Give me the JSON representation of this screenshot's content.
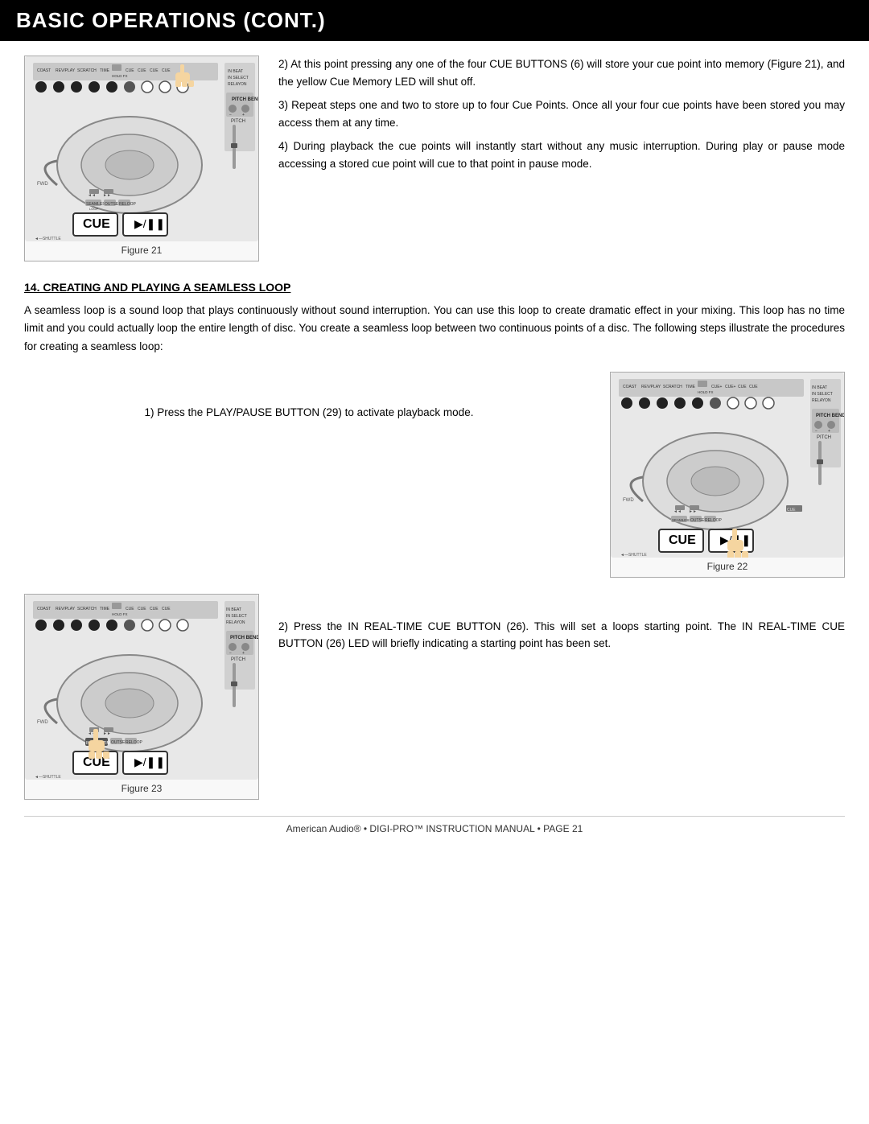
{
  "header": {
    "title": "BASIC OPERATIONS (CONT.)"
  },
  "section1": {
    "figure_label": "Figure 21",
    "points": [
      "2) At this point pressing any one of the four CUE BUTTONS (6) will store your cue point into memory (Figure 21), and the yellow Cue Memory LED will shut off.",
      "3) Repeat steps one and two to store up to four Cue Points. Once all your four cue points have been stored you may access them at any time.",
      "4) During playback the cue points will instantly start without any music interruption. During play or pause mode accessing a stored cue point will cue to that point in pause mode."
    ]
  },
  "section2": {
    "heading": "14. CREATING AND PLAYING A SEAMLESS LOOP",
    "paragraph": "A seamless loop is a sound loop that plays continuously without sound interruption. You can use this loop to create dramatic effect in your mixing. This loop has no time limit and you could actually loop the entire length of disc. You create a seamless loop between two continuous points of a disc. The following steps illustrate the procedures for creating a seamless loop:"
  },
  "section3": {
    "figure22_label": "Figure 22",
    "step1": "1) Press the PLAY/PAUSE BUTTON (29) to activate playback mode."
  },
  "section4": {
    "figure23_label": "Figure 23",
    "step2": "2) Press the IN REAL-TIME CUE BUTTON (26). This will set a loops starting point. The IN REAL-TIME CUE BUTTON (26) LED will briefly indicating a starting point has been set."
  },
  "footer": {
    "text": "American Audio® • DIGI-PRO™ INSTRUCTION MANUAL • PAGE 21"
  },
  "cue_label": "CUE"
}
